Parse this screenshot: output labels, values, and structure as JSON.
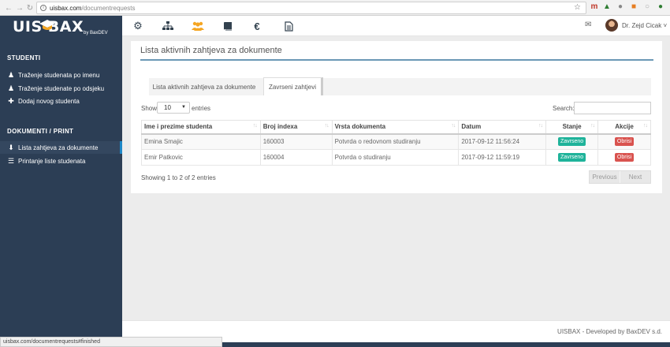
{
  "browser": {
    "url_host": "uisbax.com",
    "url_path": "/documentrequests",
    "status_url": "uisbax.com/documentrequests#finished"
  },
  "brand": {
    "logo": "UIS  BAX",
    "by": "by BaxDEV"
  },
  "topnav": {
    "icons": [
      "gears-icon",
      "sitemap-icon",
      "users-icon",
      "book-icon",
      "euro-icon",
      "document-icon"
    ],
    "user_name": "Dr. Zejd Cicak ˅"
  },
  "sidebar": {
    "section1": "STUDENTI",
    "items1": [
      {
        "label": "Traženje studenata po imenu"
      },
      {
        "label": "Traženje studenate po odsjeku"
      },
      {
        "label": "Dodaj novog studenta"
      }
    ],
    "section2": "DOKUMENTI / PRINT",
    "items2": [
      {
        "label": "Lista zahtjeva za dokumente"
      },
      {
        "label": "Printanje liste studenata"
      }
    ]
  },
  "main": {
    "title": "Lista aktivnih zahtjeva za dokumente",
    "tabs": [
      {
        "label": "Lista aktivnih zahtjeva za dokumente"
      },
      {
        "label": "Zavrseni zahtjevi"
      }
    ],
    "show_label": "Show",
    "length_value": "10",
    "entries_label": "entries",
    "search_label": "Search:",
    "columns": [
      "Ime i prezime studenta",
      "Broj indexa",
      "Vrsta dokumenta",
      "Datum",
      "Stanje",
      "Akcije"
    ],
    "rows": [
      {
        "name": "Emina Smajic",
        "index": "160003",
        "doc": "Potvrda o redovnom studiranju",
        "date": "2017-09-12 11:56:24",
        "status": "Zavrseno",
        "action": "Obrisi"
      },
      {
        "name": "Emir Patkovic",
        "index": "160004",
        "doc": "Potvrda o studiranju",
        "date": "2017-09-12 11:59:19",
        "status": "Zavrseno",
        "action": "Obrisi"
      }
    ],
    "info": "Showing 1 to 2 of 2 entries",
    "prev_label": "Previous",
    "next_label": "Next"
  },
  "footer": {
    "text": "UISBAX - Developed by BaxDEV s.d."
  },
  "colors": {
    "sidebar_bg": "#2c3e55",
    "accent_line": "#6b98b5",
    "status_green": "#1fb39a",
    "action_red": "#d9534f"
  }
}
